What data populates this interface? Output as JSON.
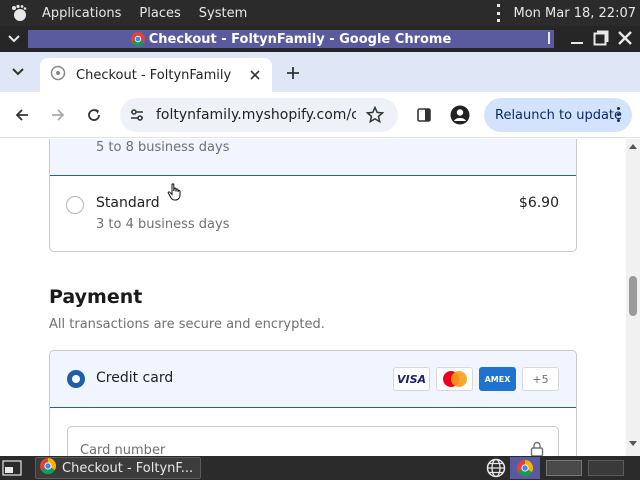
{
  "os_panel": {
    "menus": [
      "Applications",
      "Places",
      "System"
    ],
    "clock": "Mon Mar 18, 22:07"
  },
  "window": {
    "title": "Checkout - FoltynFamily - Google Chrome"
  },
  "browser": {
    "tab_title": "Checkout - FoltynFamily",
    "url": "foltynfamily.myshopify.com/c...",
    "relaunch_label": "Relaunch to update"
  },
  "shipping": {
    "express_time": "5 to 8 business days",
    "standard_name": "Standard",
    "standard_time": "3 to 4 business days",
    "standard_price": "$6.90"
  },
  "payment": {
    "heading": "Payment",
    "subtitle": "All transactions are secure and encrypted.",
    "method_label": "Credit card",
    "card_brands": [
      "VISA",
      "AMEX",
      "+5"
    ],
    "card_number_placeholder": "Card number"
  },
  "taskbar": {
    "task_label": "Checkout - FoltynF..."
  },
  "colors": {
    "accent": "#1f5fa8",
    "selected_bg": "#f0f5ff",
    "title_highlight": "#5a5a9e"
  }
}
